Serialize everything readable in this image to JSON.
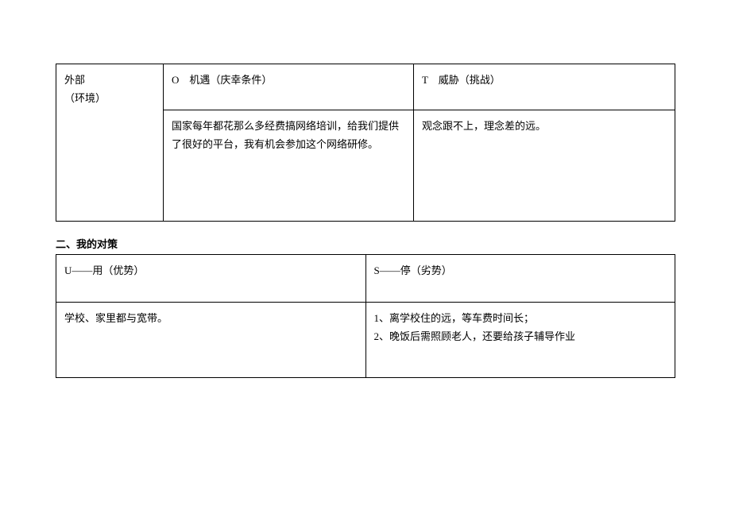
{
  "table1": {
    "rowHeader": {
      "line1": "外部",
      "line2": "（环境）"
    },
    "colO_header": "O　机遇（庆幸条件）",
    "colT_header": "T　威胁（挑战）",
    "colO_content": "国家每年都花那么多经费搞网络培训，给我们提供了很好的平台，我有机会参加这个网络研修。",
    "colT_content": "观念跟不上，理念差的远。"
  },
  "section2_title": "二、我的对策",
  "table2": {
    "colU_header": "U——用（优势）",
    "colS_header": "S——停（劣势）",
    "colU_content": "学校、家里都与宽带。",
    "colS_content_line1": "1、离学校住的远，等车费时间长；",
    "colS_content_line2": "2、晚饭后需照顾老人，还要给孩子辅导作业"
  }
}
